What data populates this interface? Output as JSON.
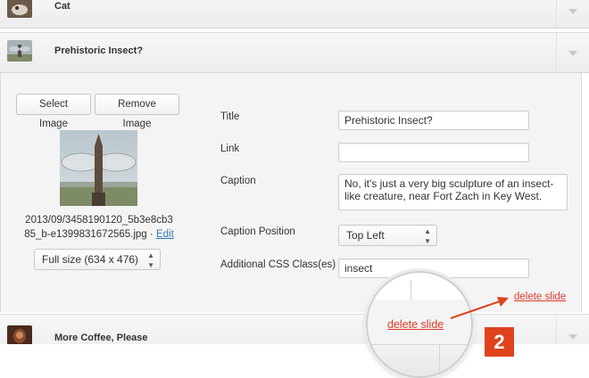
{
  "slides": [
    {
      "title": "Cat"
    },
    {
      "title": "Prehistoric Insect?"
    },
    {
      "title": "More Coffee, Please"
    }
  ],
  "editor": {
    "select_image": "Select Image",
    "remove_image": "Remove Image",
    "filename_line1": "2013/09/3458190120_5b3e8cb3",
    "filename_line2": "85_b-e1399831672565.jpg",
    "separator": "·",
    "edit_link": "Edit",
    "size_select": "Full size (634 x 476)"
  },
  "fields": {
    "title_label": "Title",
    "title_value": "Prehistoric Insect?",
    "link_label": "Link",
    "link_value": "",
    "caption_label": "Caption",
    "caption_value": "No, it's just a very big sculpture of an insect-like creature, near Fort Zach in Key West.",
    "caption_position_label": "Caption Position",
    "caption_position_value": "Top Left",
    "css_class_label": "Additional CSS Class(es)",
    "css_class_value": "insect"
  },
  "delete_link": "delete slide",
  "zoom_delete_link": "delete slide",
  "callout_number": "2",
  "colors": {
    "accent_red": "#e0421d",
    "link_blue": "#2f7ab8",
    "delete_red": "#e03a2a"
  }
}
